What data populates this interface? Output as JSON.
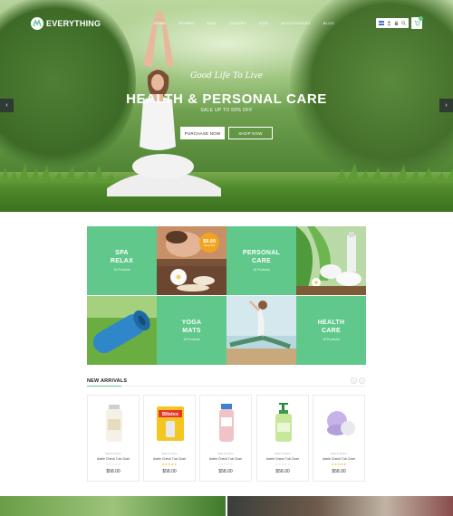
{
  "header": {
    "logo_text": "EVERYTHING",
    "nav": [
      "HOME",
      "WOMEN",
      "MEN",
      "JUNIORS",
      "KIDS",
      "ACCESSORIES",
      "BLOG"
    ],
    "utility_icons": [
      "flag-icon",
      "user-icon",
      "lock-icon",
      "search-icon"
    ],
    "cart_icon": "cart-icon"
  },
  "hero": {
    "tagline": "Good Life To Live",
    "headline": "HEALTH & PERSONAL CARE",
    "subline": "SALE UP TO 50% OFF",
    "buttons": {
      "purchase": "PURCHASE NOW",
      "shop": "SHOP NOW"
    },
    "arrows": {
      "prev": "‹",
      "next": "›"
    }
  },
  "categories": [
    {
      "title_line1": "SPA",
      "title_line2": "RELAX",
      "count": "16 Products"
    },
    {
      "title_line1": "PERSONAL",
      "title_line2": "CARE",
      "count": "16 Products"
    },
    {
      "title_line1": "YOGA",
      "title_line2": "MATS",
      "count": "16 Products"
    },
    {
      "title_line1": "HEALTH",
      "title_line2": "CARE",
      "count": "16 Products"
    }
  ],
  "promo_badge": {
    "price": "$9.99",
    "note": "SALE OFF"
  },
  "new_arrivals": {
    "title": "NEW ARRIVALS",
    "prev": "‹",
    "next": "›",
    "products": [
      {
        "category": "Sale & Charm",
        "name": "Adele Check Tub Chair",
        "stars": "★★★★★",
        "rating": 0,
        "price": "$58.00"
      },
      {
        "category": "Sale & Charm",
        "name": "Adele Check Tub Chair",
        "stars": "★★★★★",
        "rating": 5,
        "price": "$58.00"
      },
      {
        "category": "Sale & Charm",
        "name": "Adele Check Tub Chair",
        "stars": "★★★★★",
        "rating": 0,
        "price": "$58.00"
      },
      {
        "category": "Sale & Charm",
        "name": "Adele Check Tub Chair",
        "stars": "★★★★★",
        "rating": 0,
        "price": "$58.00"
      },
      {
        "category": "Sale & Charm",
        "name": "Adele Check Tub Chair",
        "stars": "★★★★★",
        "rating": 5,
        "price": "$58.00"
      }
    ]
  },
  "colors": {
    "accent": "#60c88b",
    "badge": "#f2a420",
    "star": "#f2b11d"
  }
}
